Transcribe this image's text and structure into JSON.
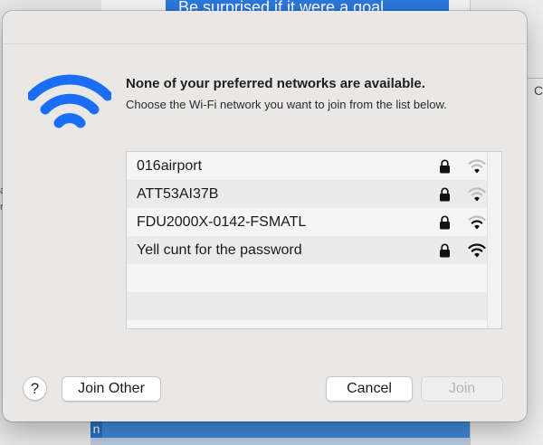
{
  "background": {
    "highlighted_text": "Be surprised if it were a goal",
    "right_panel_letter": "C",
    "left_marks": [
      "a",
      "r"
    ],
    "bottom_letter": "n"
  },
  "dialog": {
    "title": "None of your preferred networks are available.",
    "subtitle": "Choose the Wi-Fi network you want to join from the list below.",
    "hero_icon": "wifi-icon",
    "accent_color": "#1a6ef5",
    "networks": [
      {
        "name": "016airport",
        "secured": true,
        "signal_bars": 1
      },
      {
        "name": "ATT53AI37B",
        "secured": true,
        "signal_bars": 1
      },
      {
        "name": "FDU2000X-0142-FSMATL",
        "secured": true,
        "signal_bars": 2
      },
      {
        "name": "Yell cunt for the password",
        "secured": true,
        "signal_bars": 3
      }
    ],
    "buttons": {
      "help": "?",
      "join_other": "Join Other",
      "cancel": "Cancel",
      "join": "Join"
    }
  }
}
